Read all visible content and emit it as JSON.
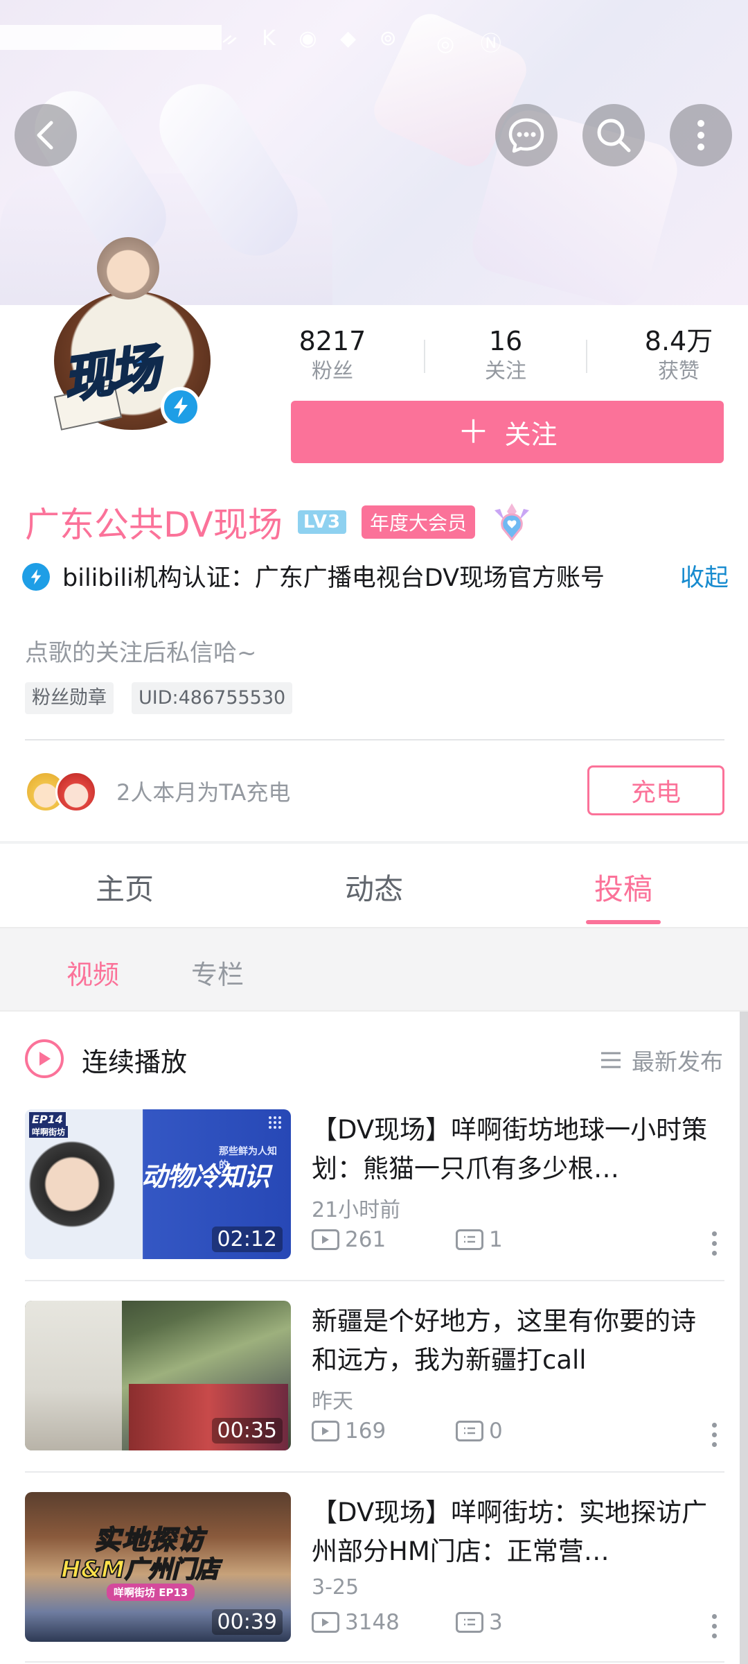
{
  "status_bar": {
    "icons": "ᨀ K ◉ ◆ ⊚",
    "right_icons": "◎ Ⓝ"
  },
  "header": {
    "back_label": "back",
    "message_label": "message",
    "search_label": "search",
    "more_label": "more"
  },
  "profile": {
    "avatar_text": "现场",
    "stats": [
      {
        "value": "8217",
        "label": "粉丝"
      },
      {
        "value": "16",
        "label": "关注"
      },
      {
        "value": "8.4万",
        "label": "获赞"
      }
    ],
    "follow_label": "关注",
    "follow_plus": "＋",
    "name": "广东公共DV现场",
    "level": "LV3",
    "vip_badge": "年度大会员",
    "certification": "bilibili机构认证：广东广播电视台DV现场官方账号",
    "collapse_label": "收起",
    "sign": "点歌的关注后私信哈~",
    "tags": [
      "粉丝勋章",
      "UID:486755530"
    ]
  },
  "charge": {
    "text": "2人本月为TA充电",
    "button": "充电"
  },
  "tabs": [
    {
      "label": "主页",
      "active": false
    },
    {
      "label": "动态",
      "active": false
    },
    {
      "label": "投稿",
      "active": true
    }
  ],
  "subtabs": [
    {
      "label": "视频",
      "active": true
    },
    {
      "label": "专栏",
      "active": false
    }
  ],
  "list_header": {
    "play_all": "连续播放",
    "sort": "最新发布"
  },
  "videos": [
    {
      "title": "【DV现场】咩啊街坊地球一小时策划：熊猫一只爪有多少根…",
      "date": "21小时前",
      "duration": "02:12",
      "plays": "261",
      "comments": "1",
      "thumb_caption": "动物冷知识",
      "thumb_tag": "EP14",
      "thumb_sub": "咩啊街坊",
      "thumb_banner": "那些鲜为人知的…"
    },
    {
      "title": "新疆是个好地方，这里有你要的诗和远方，我为新疆打call",
      "date": "昨天",
      "duration": "00:35",
      "plays": "169",
      "comments": "0"
    },
    {
      "title": "【DV现场】咩啊街坊：实地探访广州部分HM门店：正常营…",
      "date": "3-25",
      "duration": "00:39",
      "plays": "3148",
      "comments": "3",
      "thumb_caption": "实地探访",
      "thumb_caption2": "H&M广州门店",
      "thumb_sub": "咩啊街坊 EP13"
    }
  ],
  "colors": {
    "accent": "#fb7299",
    "link": "#178bcf",
    "muted": "#9499a0"
  }
}
